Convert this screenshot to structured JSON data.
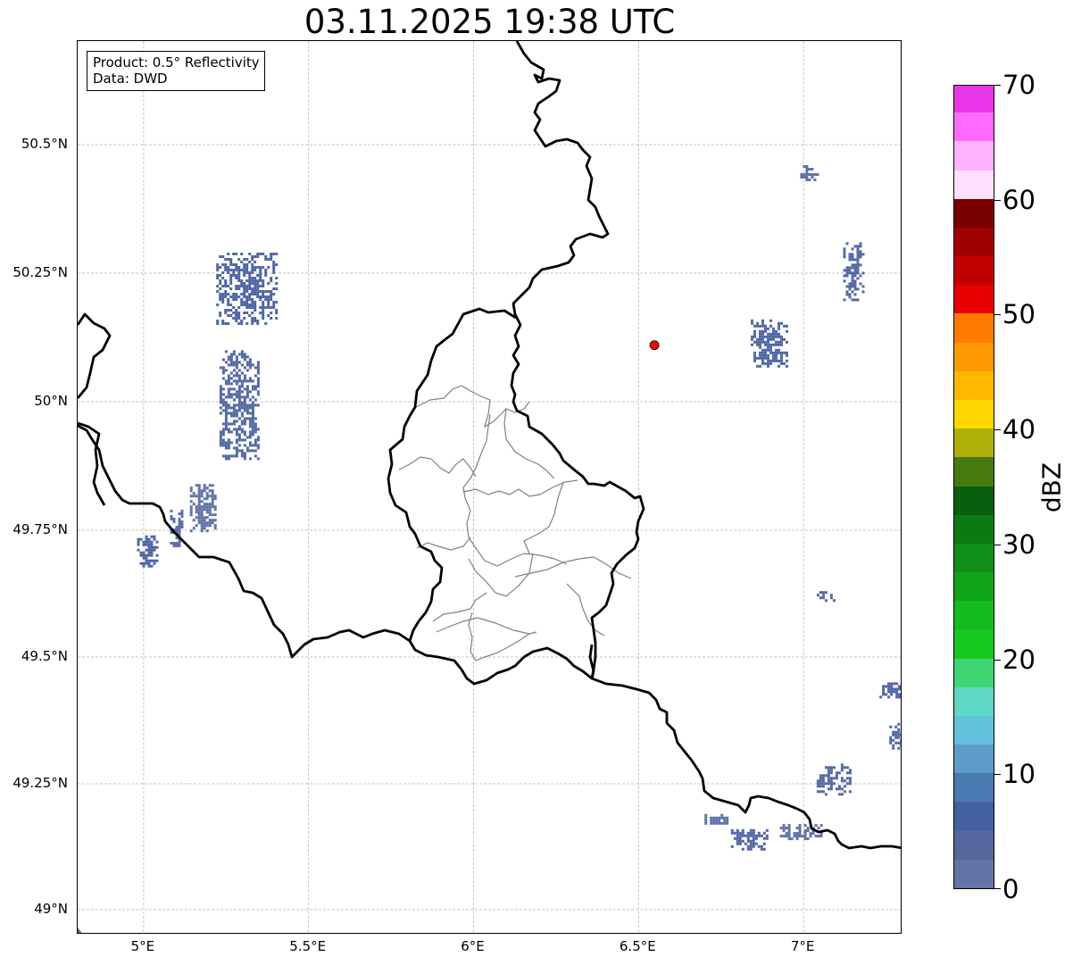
{
  "title": "03.11.2025 19:38 UTC",
  "info_box": {
    "line1": "Product: 0.5° Reflectivity",
    "line2": "Data: DWD"
  },
  "map": {
    "extent": {
      "lon_min": 4.8,
      "lon_max": 7.3,
      "lat_min": 48.95,
      "lat_max": 50.7
    },
    "gridlines": true,
    "lat_ticks": [
      {
        "value": 50.5,
        "label": "50.5°N"
      },
      {
        "value": 50.25,
        "label": "50.25°N"
      },
      {
        "value": 50.0,
        "label": "50°N"
      },
      {
        "value": 49.75,
        "label": "49.75°N"
      },
      {
        "value": 49.5,
        "label": "49.5°N"
      },
      {
        "value": 49.25,
        "label": "49.25°N"
      },
      {
        "value": 49.0,
        "label": "49°N"
      }
    ],
    "lon_ticks": [
      {
        "value": 5.0,
        "label": "5°E"
      },
      {
        "value": 5.5,
        "label": "5.5°E"
      },
      {
        "value": 6.0,
        "label": "6°E"
      },
      {
        "value": 6.5,
        "label": "6.5°E"
      },
      {
        "value": 7.0,
        "label": "7°E"
      }
    ],
    "radar_site": {
      "lon": 6.548,
      "lat": 50.11,
      "color": "#ff0000"
    },
    "colors": {
      "border": "#000000",
      "internal_boundary": "#808080",
      "grid": "#b0b0b0"
    },
    "echo_areas": [
      {
        "lon_min": 5.22,
        "lon_max": 5.4,
        "lat_min": 50.15,
        "lat_max": 50.29,
        "color": "#4f66a6"
      },
      {
        "lon_min": 5.23,
        "lon_max": 5.35,
        "lat_min": 49.89,
        "lat_max": 50.1,
        "color": "#5468a4"
      },
      {
        "lon_min": 5.14,
        "lon_max": 5.22,
        "lat_min": 49.75,
        "lat_max": 49.84,
        "color": "#5e71a8"
      },
      {
        "lon_min": 4.98,
        "lon_max": 5.04,
        "lat_min": 49.68,
        "lat_max": 49.74,
        "color": "#4f66a6"
      },
      {
        "lon_min": 5.08,
        "lon_max": 5.12,
        "lat_min": 49.72,
        "lat_max": 49.79,
        "color": "#6070a8"
      },
      {
        "lon_min": 6.84,
        "lon_max": 6.95,
        "lat_min": 50.07,
        "lat_max": 50.16,
        "color": "#5168a7"
      },
      {
        "lon_min": 7.12,
        "lon_max": 7.18,
        "lat_min": 50.2,
        "lat_max": 50.31,
        "color": "#5468a4"
      },
      {
        "lon_min": 6.99,
        "lon_max": 7.04,
        "lat_min": 50.43,
        "lat_max": 50.46,
        "color": "#5e71a8"
      },
      {
        "lon_min": 7.04,
        "lon_max": 7.09,
        "lat_min": 49.61,
        "lat_max": 49.63,
        "color": "#5468a4"
      },
      {
        "lon_min": 7.23,
        "lon_max": 7.3,
        "lat_min": 49.42,
        "lat_max": 49.45,
        "color": "#4f66a6"
      },
      {
        "lon_min": 7.26,
        "lon_max": 7.3,
        "lat_min": 49.32,
        "lat_max": 49.37,
        "color": "#4f66a6"
      },
      {
        "lon_min": 7.04,
        "lon_max": 7.14,
        "lat_min": 49.23,
        "lat_max": 49.29,
        "color": "#5468a4"
      },
      {
        "lon_min": 6.7,
        "lon_max": 6.78,
        "lat_min": 49.17,
        "lat_max": 49.19,
        "color": "#5e71a8"
      },
      {
        "lon_min": 6.78,
        "lon_max": 6.89,
        "lat_min": 49.12,
        "lat_max": 49.16,
        "color": "#4f66a6"
      },
      {
        "lon_min": 6.92,
        "lon_max": 7.05,
        "lat_min": 49.14,
        "lat_max": 49.17,
        "color": "#5e71a8"
      }
    ]
  },
  "colorbar": {
    "unit": "dBZ",
    "min": 0,
    "max": 70,
    "tick_values": [
      0,
      10,
      20,
      30,
      40,
      50,
      60,
      70
    ],
    "tick_labels": [
      "0",
      "10",
      "20",
      "30",
      "40",
      "50",
      "60",
      "70"
    ],
    "colors": [
      "#6574a6",
      "#56689f",
      "#4360a0",
      "#4a78b0",
      "#5d9cc8",
      "#62c1dc",
      "#5fd8c4",
      "#3dd672",
      "#14c81e",
      "#12bc1c",
      "#11a61a",
      "#108f19",
      "#0c7a12",
      "#095e0c",
      "#467a0f",
      "#adb10a",
      "#ffd700",
      "#ffb700",
      "#ff9800",
      "#ff7b00",
      "#e80000",
      "#c20000",
      "#a00000",
      "#7a0000",
      "#ffe0ff",
      "#ffb2ff",
      "#ff6bff",
      "#e836e8"
    ]
  }
}
